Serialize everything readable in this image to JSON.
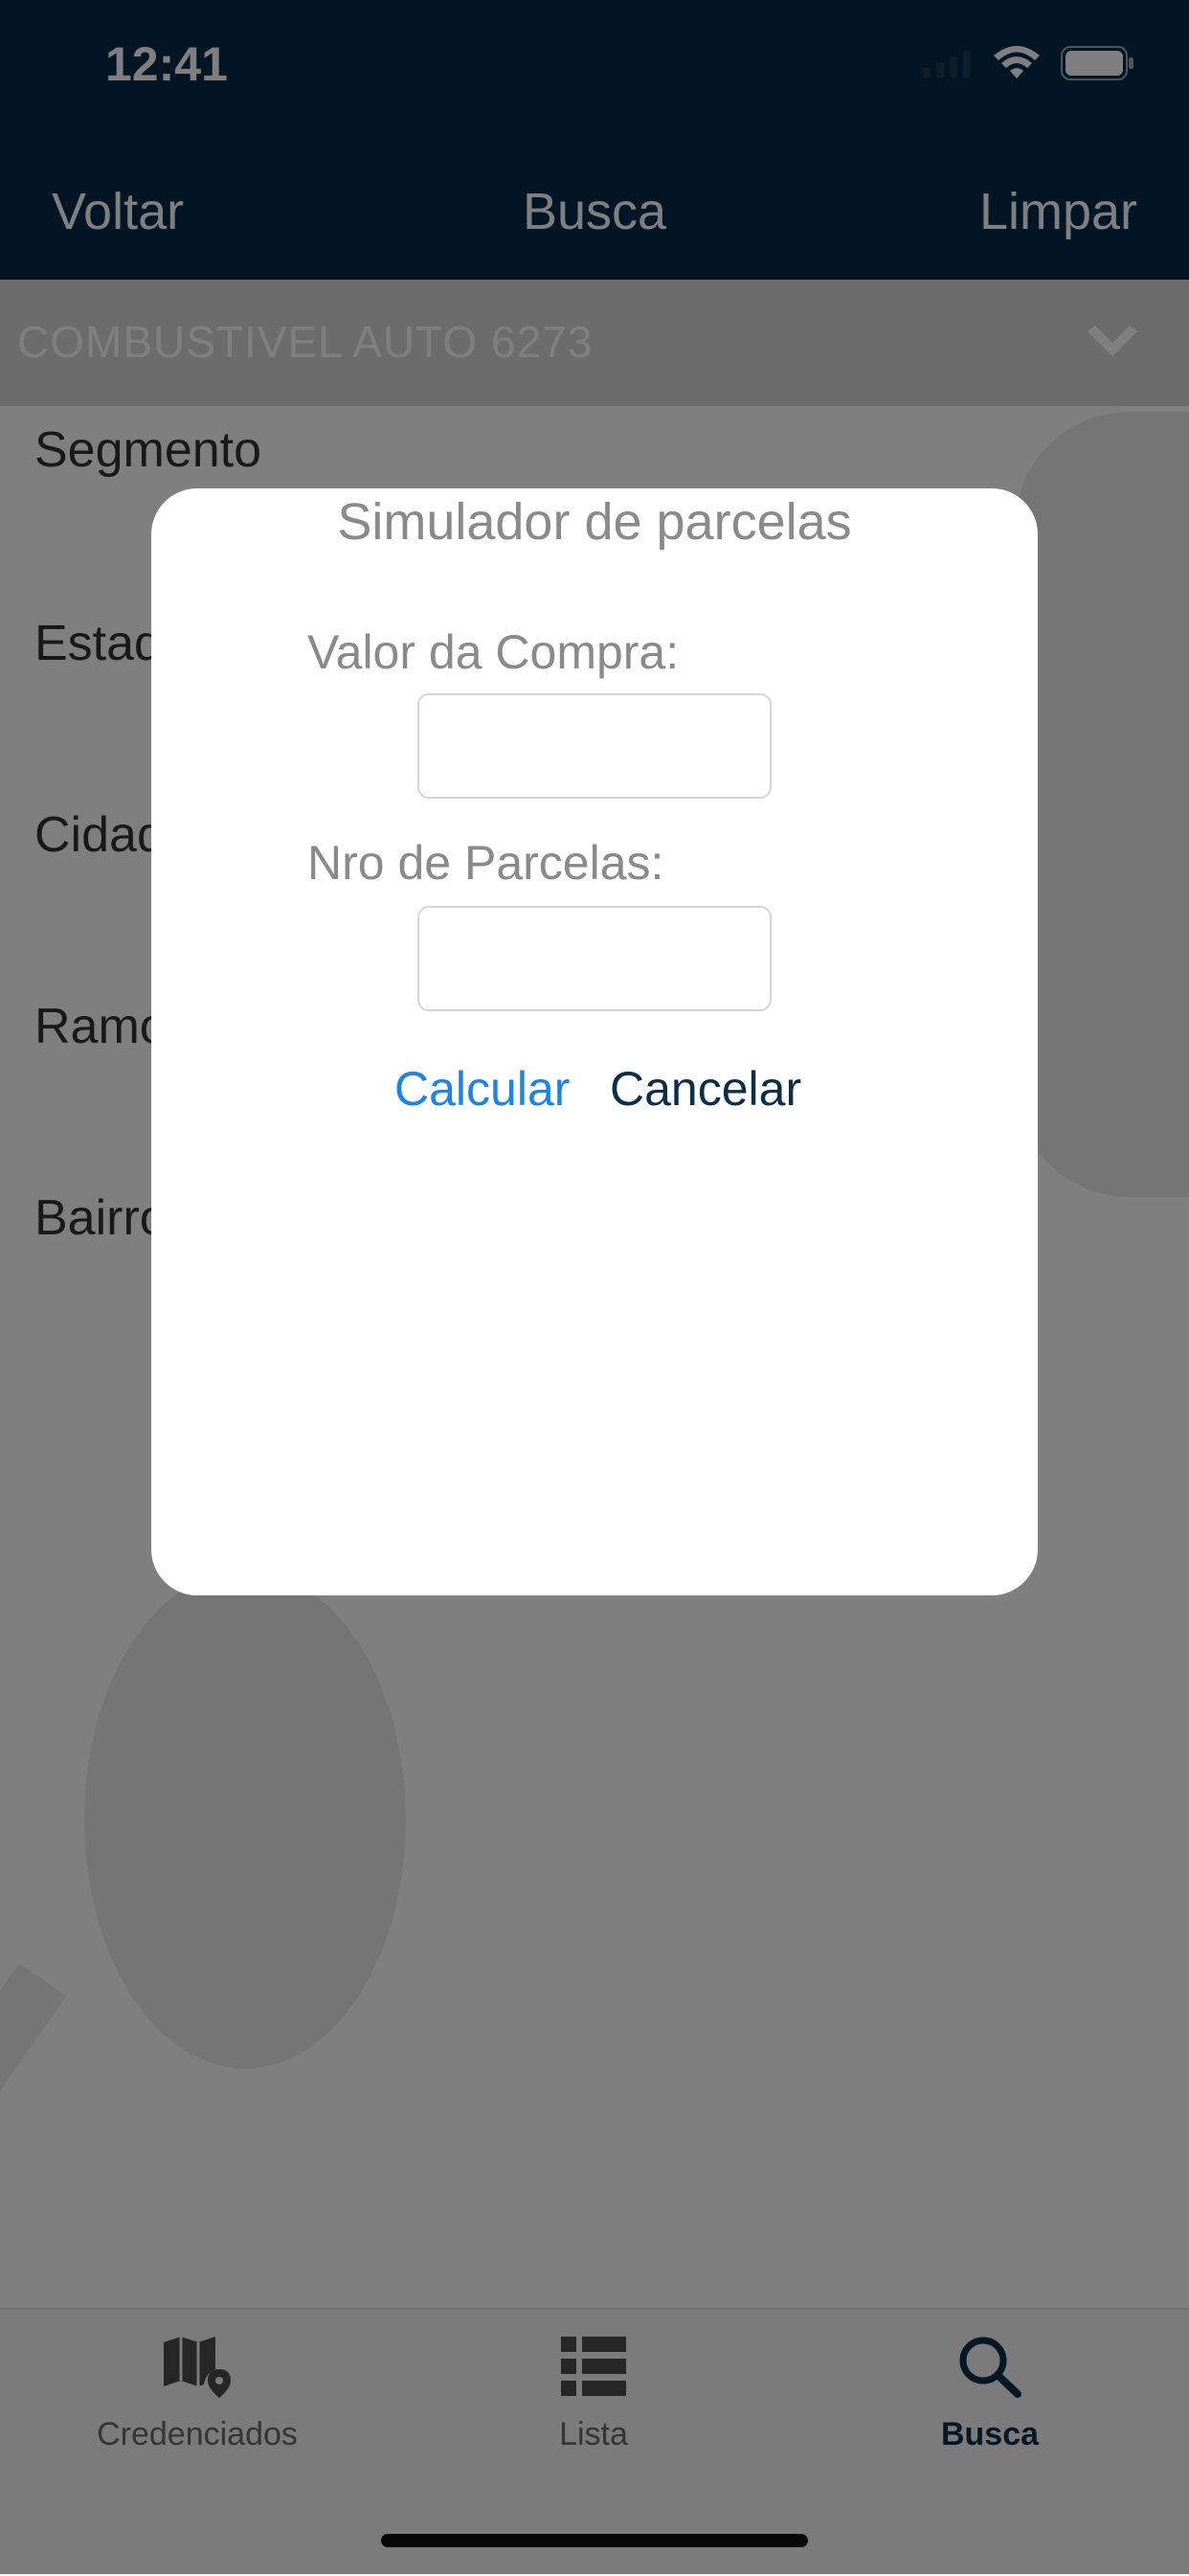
{
  "status": {
    "time": "12:41"
  },
  "nav": {
    "back": "Voltar",
    "title": "Busca",
    "clear": "Limpar"
  },
  "category": {
    "label": "COMBUSTIVEL AUTO  6273"
  },
  "form": {
    "labels": [
      "Segmento",
      "Estado",
      "Cidade",
      "Ramo",
      "Bairro"
    ]
  },
  "modal": {
    "title": "Simulador de parcelas",
    "purchase_label": "Valor da Compra:",
    "purchase_value": "",
    "installments_label": "Nro de Parcelas:",
    "installments_value": "",
    "calculate": "Calcular",
    "cancel": "Cancelar"
  },
  "tabbar": {
    "items": [
      {
        "label": "Credenciados",
        "icon": "map-pin-icon"
      },
      {
        "label": "Lista",
        "icon": "list-icon"
      },
      {
        "label": "Busca",
        "icon": "search-icon",
        "active": true
      }
    ]
  },
  "colors": {
    "navbar": "#032b4a",
    "accent": "#1a84e8",
    "active_tab": "#0b2e4a",
    "overlay": "rgba(0,0,0,0.50)"
  }
}
